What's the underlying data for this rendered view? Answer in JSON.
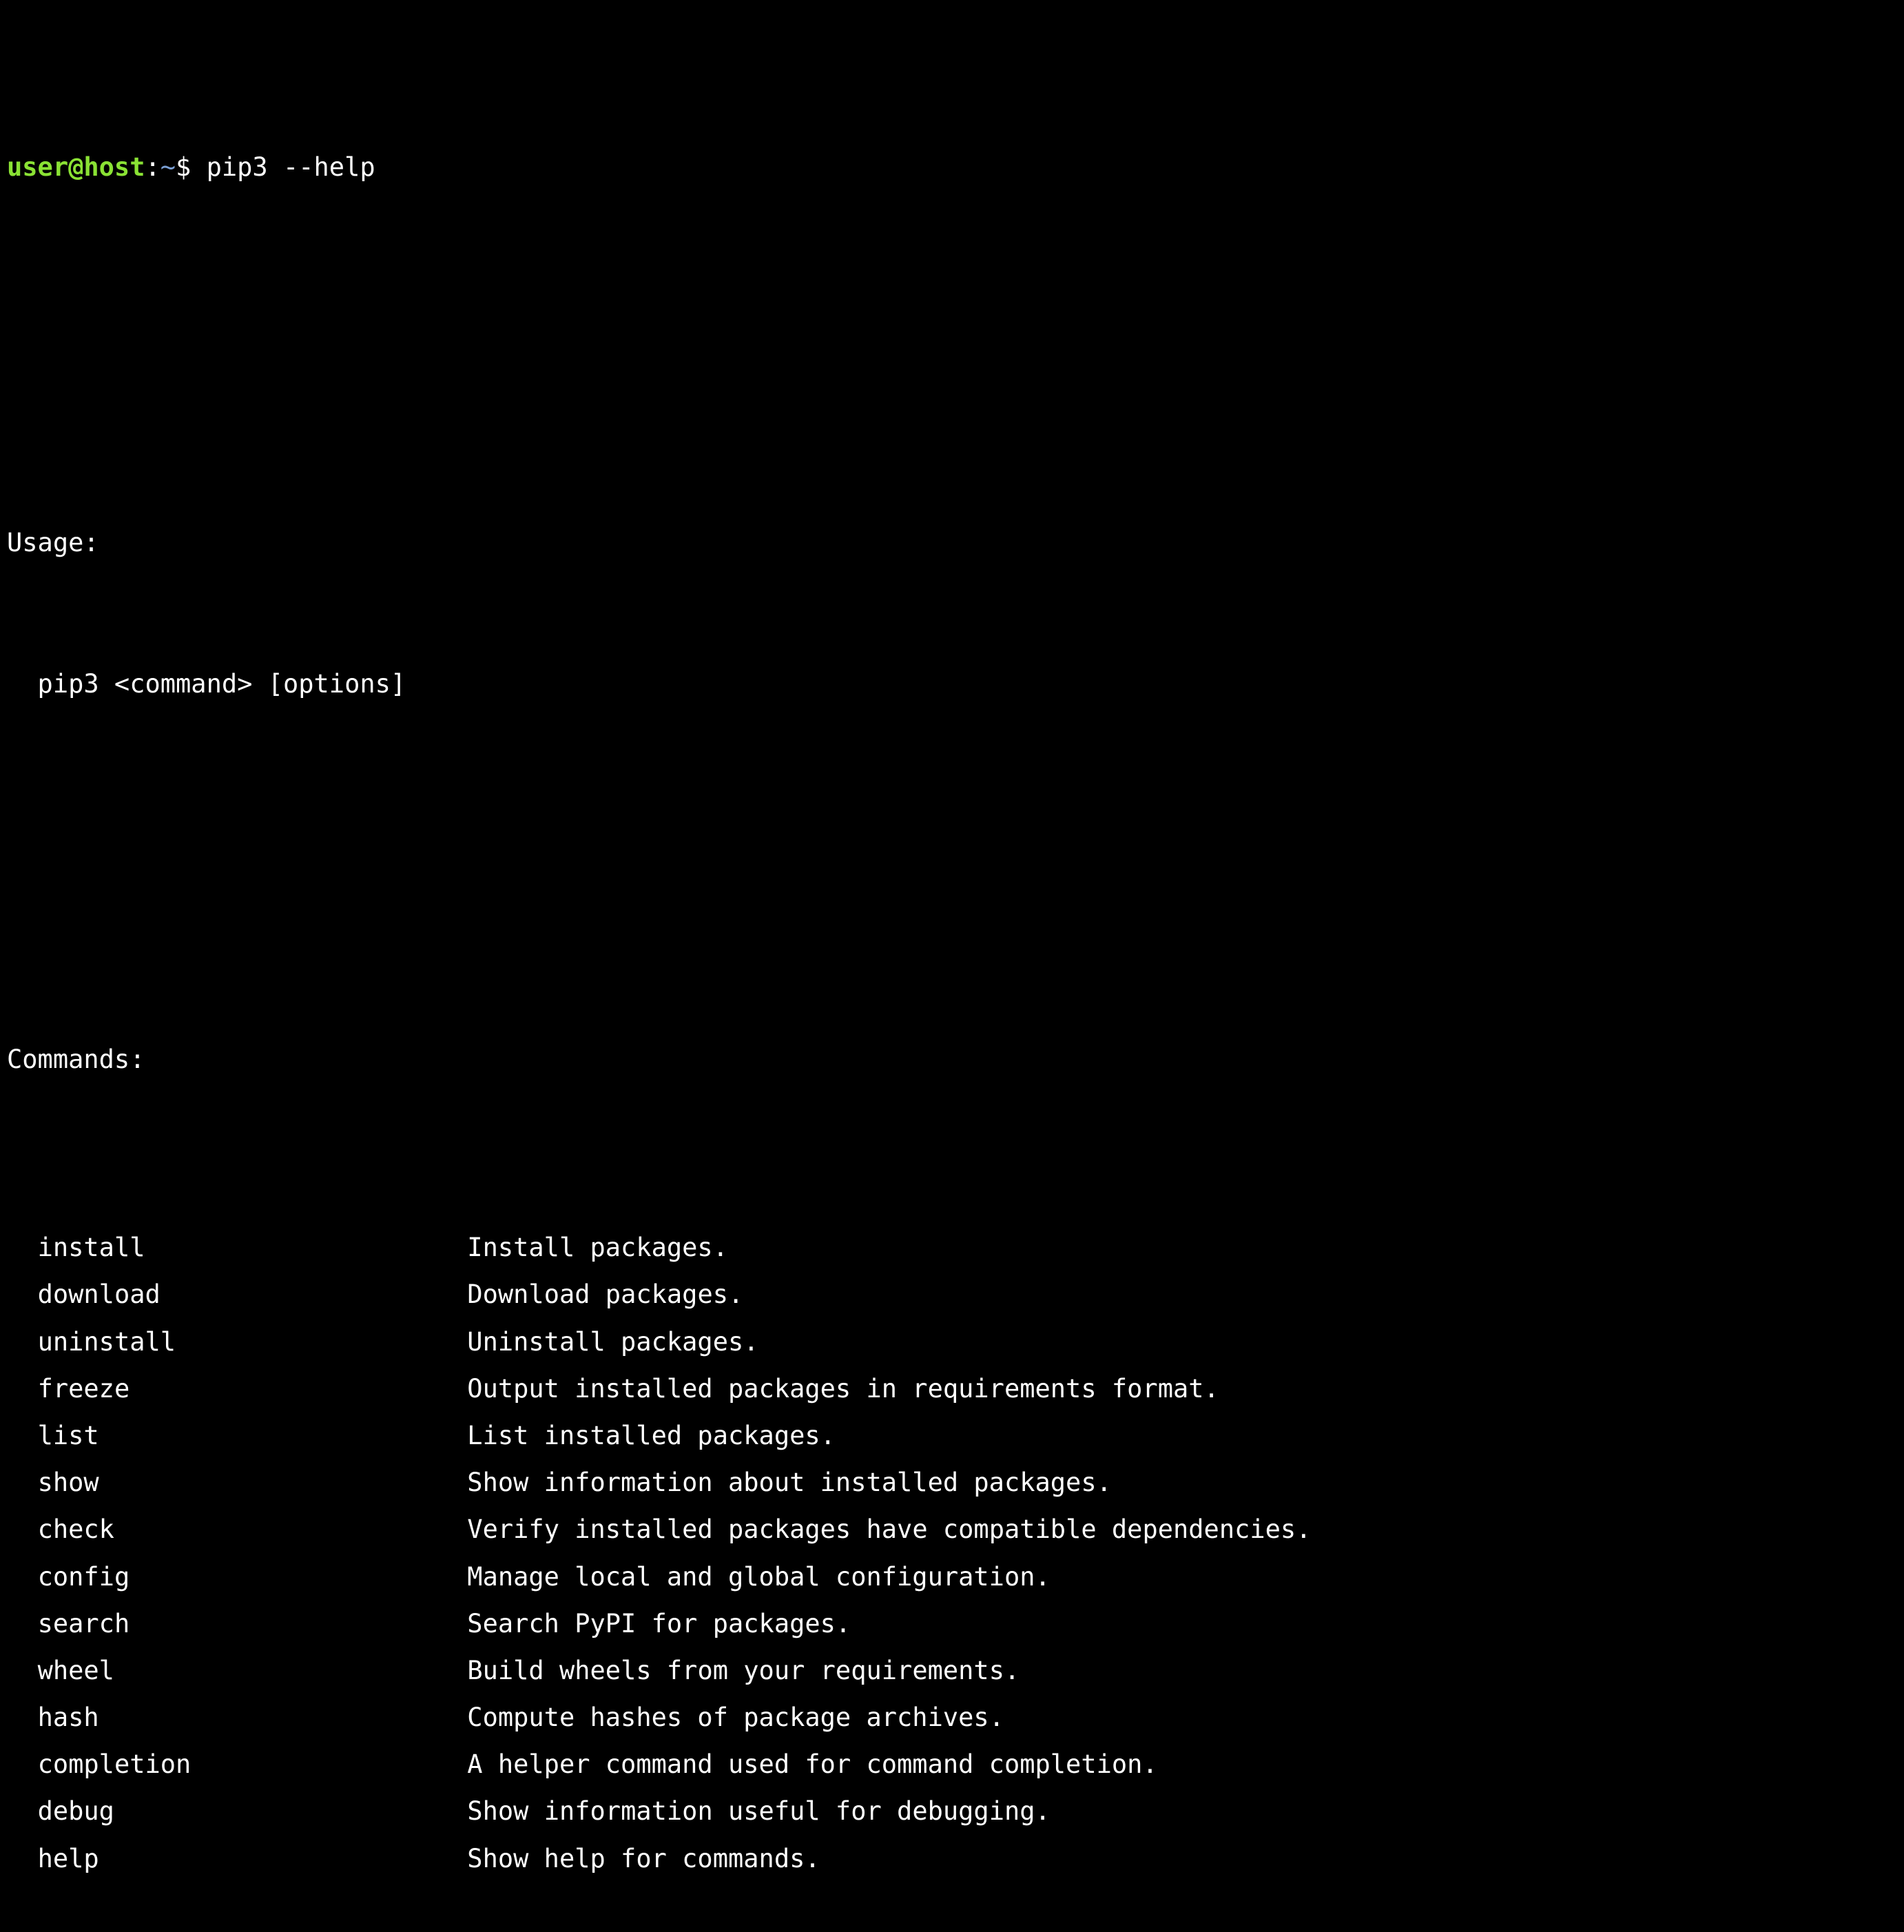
{
  "terminal": {
    "background_color": "#000000",
    "foreground_color": "#ffffff",
    "prompt": {
      "user_host": "user@host",
      "user_host_color": "#8ae234",
      "colon": ":",
      "path": "~",
      "path_color": "#7a9fd4",
      "sigil": "$",
      "command": " pip3 --help"
    }
  },
  "output": {
    "usage_heading": "Usage:",
    "usage_line": "  pip3 <command> [options]",
    "commands_heading": "Commands:",
    "command_indent": "  ",
    "desc_column": 30,
    "commands": [
      {
        "name": "install",
        "description": "Install packages."
      },
      {
        "name": "download",
        "description": "Download packages."
      },
      {
        "name": "uninstall",
        "description": "Uninstall packages."
      },
      {
        "name": "freeze",
        "description": "Output installed packages in requirements format."
      },
      {
        "name": "list",
        "description": "List installed packages."
      },
      {
        "name": "show",
        "description": "Show information about installed packages."
      },
      {
        "name": "check",
        "description": "Verify installed packages have compatible dependencies."
      },
      {
        "name": "config",
        "description": "Manage local and global configuration."
      },
      {
        "name": "search",
        "description": "Search PyPI for packages."
      },
      {
        "name": "wheel",
        "description": "Build wheels from your requirements."
      },
      {
        "name": "hash",
        "description": "Compute hashes of package archives."
      },
      {
        "name": "completion",
        "description": "A helper command used for command completion."
      },
      {
        "name": "debug",
        "description": "Show information useful for debugging."
      },
      {
        "name": "help",
        "description": "Show help for commands."
      }
    ]
  }
}
